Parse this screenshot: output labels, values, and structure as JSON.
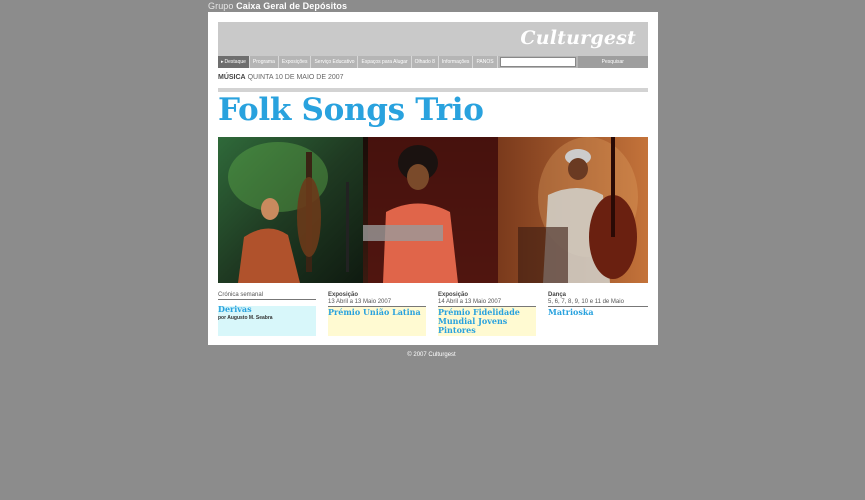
{
  "header": {
    "group_prefix": "Grupo",
    "group_name": "Caixa Geral de Depósitos",
    "logo": "Culturgest"
  },
  "nav": {
    "items": [
      {
        "label": "Destaque",
        "active": true
      },
      {
        "label": "Programa",
        "active": false
      },
      {
        "label": "Exposições",
        "active": false
      },
      {
        "label": "Serviço Educativo",
        "active": false
      },
      {
        "label": "Espaços para Alugar",
        "active": false
      },
      {
        "label": "Olhado 8",
        "active": false
      },
      {
        "label": "Informações",
        "active": false
      },
      {
        "label": "PANOS",
        "active": false
      }
    ],
    "search_placeholder": "",
    "search_button": "Pesquisar"
  },
  "crumb": {
    "category": "MÚSICA",
    "date": "QUINTA 10 DE MAIO DE 2007"
  },
  "page_title": "Folk Songs Trio",
  "features": [
    {
      "label": "Crónica semanal",
      "date": "",
      "title": "Derivas",
      "byline": "por Augusto M. Seabra",
      "color": "#d8f7fa"
    },
    {
      "label": "Exposição",
      "date": "13 Abril a 13 Maio 2007",
      "title": "Prémio União Latina",
      "byline": "",
      "color": "#fffad2"
    },
    {
      "label": "Exposição",
      "date": "14 Abril a 13 Maio 2007",
      "title": "Prémio Fidelidade Mundial Jovens Pintores",
      "byline": "",
      "color": "#fffad2"
    },
    {
      "label": "Dança",
      "date": "5, 6, 7, 8, 9, 10 e 11 de Maio",
      "title": "Matrioska",
      "byline": "",
      "color": "#ffffff"
    }
  ],
  "footer": "© 2007 Culturgest",
  "colors": {
    "background": "#8c8c8c",
    "title_blue": "#29a2de",
    "nav_grey": "#b5b5b5"
  }
}
